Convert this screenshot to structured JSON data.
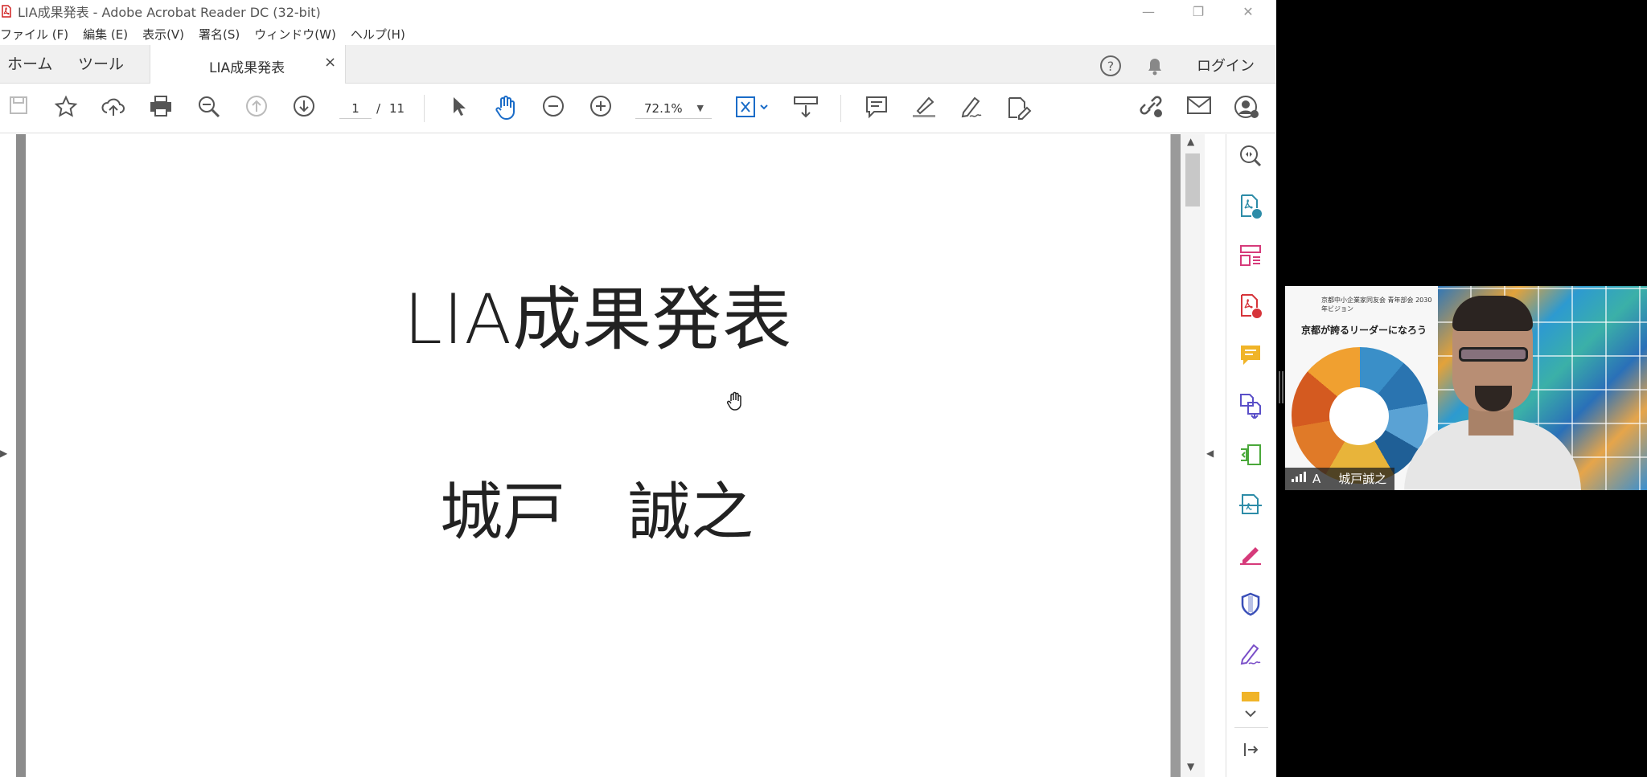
{
  "window": {
    "title": "LIA成果発表 - Adobe Acrobat Reader DC (32-bit)",
    "minimize_glyph": "—",
    "restore_glyph": "❐",
    "close_glyph": "✕"
  },
  "menu": [
    "ファイル (F)",
    "編集 (E)",
    "表示(V)",
    "署名(S)",
    "ウィンドウ(W)",
    "ヘルプ(H)"
  ],
  "tabs": {
    "home": "ホーム",
    "tools": "ツール",
    "document": "LIA成果発表",
    "close_glyph": "×"
  },
  "header": {
    "login": "ログイン"
  },
  "toolbar": {
    "page_current": "1",
    "page_separator": "/",
    "page_total": "11",
    "zoom": "72.1%",
    "icons": [
      "save-icon",
      "bookmark-star-icon",
      "upload-cloud-icon",
      "print-icon",
      "zoom-search-icon",
      "page-up-icon",
      "page-down-icon",
      "select-arrow-icon",
      "hand-icon",
      "zoom-out-icon",
      "zoom-in-icon",
      "fit-page-icon",
      "scroll-mode-icon",
      "comment-icon",
      "highlight-icon",
      "draw-sign-icon",
      "edit-pdf-icon",
      "share-link-icon",
      "email-icon",
      "account-icon"
    ]
  },
  "document": {
    "title": "LIA成果発表",
    "author": "城戸　誠之"
  },
  "right_pane": {
    "icons": [
      "zoom-search-icon",
      "export-pdf-icon",
      "organize-pages-icon",
      "create-pdf-icon",
      "comment-icon",
      "combine-files-icon",
      "compress-icon",
      "scan-icon",
      "fill-sign-icon",
      "protect-icon",
      "sign-icon",
      "more-tools-icon",
      "expand-icon",
      "exit-icon"
    ]
  },
  "video": {
    "participant_label": "城戸誠之",
    "mic_letter": "A",
    "slide_header": "京都中小企業家同友会 青年部会 2030年ビジョン",
    "slide_headline": "京都が誇るリーダーになろう"
  }
}
